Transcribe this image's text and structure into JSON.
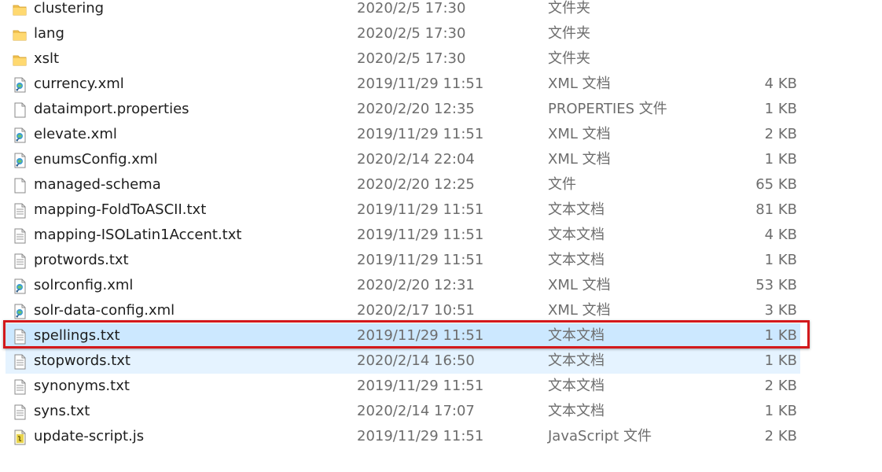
{
  "files": [
    {
      "name": "clustering",
      "date": "2020/2/5 17:30",
      "type": "文件夹",
      "size": "",
      "icon": "folder-icon"
    },
    {
      "name": "lang",
      "date": "2020/2/5 17:30",
      "type": "文件夹",
      "size": "",
      "icon": "folder-icon"
    },
    {
      "name": "xslt",
      "date": "2020/2/5 17:30",
      "type": "文件夹",
      "size": "",
      "icon": "folder-icon"
    },
    {
      "name": "currency.xml",
      "date": "2019/11/29 11:51",
      "type": "XML 文档",
      "size": "4 KB",
      "icon": "xml-file-icon"
    },
    {
      "name": "dataimport.properties",
      "date": "2020/2/20 12:35",
      "type": "PROPERTIES 文件",
      "size": "1 KB",
      "icon": "blank-file-icon"
    },
    {
      "name": "elevate.xml",
      "date": "2019/11/29 11:51",
      "type": "XML 文档",
      "size": "2 KB",
      "icon": "xml-file-icon"
    },
    {
      "name": "enumsConfig.xml",
      "date": "2020/2/14 22:04",
      "type": "XML 文档",
      "size": "1 KB",
      "icon": "xml-file-icon"
    },
    {
      "name": "managed-schema",
      "date": "2020/2/20 12:25",
      "type": "文件",
      "size": "65 KB",
      "icon": "blank-file-icon"
    },
    {
      "name": "mapping-FoldToASCII.txt",
      "date": "2019/11/29 11:51",
      "type": "文本文档",
      "size": "81 KB",
      "icon": "text-file-icon"
    },
    {
      "name": "mapping-ISOLatin1Accent.txt",
      "date": "2019/11/29 11:51",
      "type": "文本文档",
      "size": "4 KB",
      "icon": "text-file-icon"
    },
    {
      "name": "protwords.txt",
      "date": "2019/11/29 11:51",
      "type": "文本文档",
      "size": "1 KB",
      "icon": "text-file-icon"
    },
    {
      "name": "solrconfig.xml",
      "date": "2020/2/20 12:31",
      "type": "XML 文档",
      "size": "53 KB",
      "icon": "xml-file-icon"
    },
    {
      "name": "solr-data-config.xml",
      "date": "2020/2/17 10:51",
      "type": "XML 文档",
      "size": "3 KB",
      "icon": "xml-file-icon"
    },
    {
      "name": "spellings.txt",
      "date": "2019/11/29 11:51",
      "type": "文本文档",
      "size": "1 KB",
      "icon": "text-file-icon",
      "state": "selected"
    },
    {
      "name": "stopwords.txt",
      "date": "2020/2/14 16:50",
      "type": "文本文档",
      "size": "1 KB",
      "icon": "text-file-icon",
      "state": "hover"
    },
    {
      "name": "synonyms.txt",
      "date": "2019/11/29 11:51",
      "type": "文本文档",
      "size": "2 KB",
      "icon": "text-file-icon"
    },
    {
      "name": "syns.txt",
      "date": "2020/2/14 17:07",
      "type": "文本文档",
      "size": "1 KB",
      "icon": "text-file-icon"
    },
    {
      "name": "update-script.js",
      "date": "2019/11/29 11:51",
      "type": "JavaScript 文件",
      "size": "2 KB",
      "icon": "js-file-icon"
    }
  ],
  "colors": {
    "selection": "#cce8ff",
    "hover": "#e5f3ff",
    "annotation_border": "#d3191c",
    "folder": "#f2c24f"
  }
}
